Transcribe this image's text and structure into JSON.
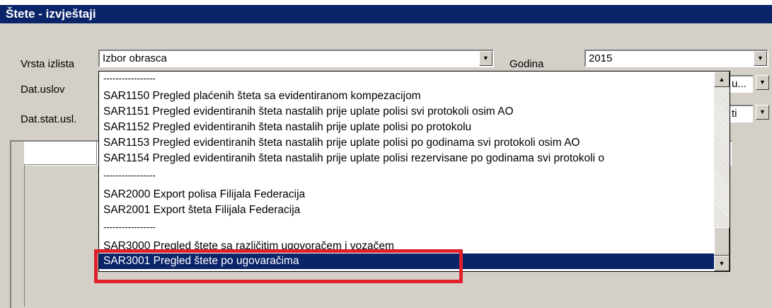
{
  "window": {
    "title": "Štete - izvještaji"
  },
  "form": {
    "vrsta_label": "Vrsta izlista",
    "vrsta_value": "Izbor obrasca",
    "godina_label": "Godina",
    "godina_value": "2015",
    "datuslov_label": "Dat.uslov",
    "datuslov_value": "u...",
    "datstat_label": "Dat.stat.usl.",
    "datstat_value": "ti"
  },
  "dropdown": {
    "items": [
      {
        "text": "-----------------",
        "type": "separator"
      },
      {
        "text": "SAR1150 Pregled plaćenih šteta sa evidentiranom kompezacijom",
        "type": "item"
      },
      {
        "text": "SAR1151 Pregled evidentiranih šteta nastalih prije uplate polisi svi protokoli osim AO",
        "type": "item"
      },
      {
        "text": "SAR1152 Pregled evidentiranih šteta nastalih prije uplate polisi po protokolu",
        "type": "item"
      },
      {
        "text": "SAR1153 Pregled evidentiranih šteta nastalih prije uplate polisi po godinama svi protokoli osim AO",
        "type": "item"
      },
      {
        "text": "SAR1154 Pregled evidentiranih šteta nastalih prije uplate polisi rezervisane po godinama svi protokoli o",
        "type": "item"
      },
      {
        "text": "-----------------",
        "type": "separator"
      },
      {
        "text": "SAR2000 Export polisa Filijala Federacija",
        "type": "item"
      },
      {
        "text": "SAR2001 Export šteta Filijala Federacija",
        "type": "item"
      },
      {
        "text": "-----------------",
        "type": "separator"
      },
      {
        "text": "SAR3000 Pregled štete sa različitim ugovoračem i vozačem",
        "type": "item"
      },
      {
        "text": "SAR3001 Pregled štete po ugovaračima",
        "type": "selected"
      }
    ]
  },
  "colors": {
    "titlebar": "#0a246a",
    "selection": "#0a246a",
    "highlight": "#e0202a",
    "face": "#d4d0c8"
  },
  "icons": {
    "dropdown": "triangle-down",
    "scroll_up": "triangle-up",
    "scroll_down": "triangle-down"
  }
}
